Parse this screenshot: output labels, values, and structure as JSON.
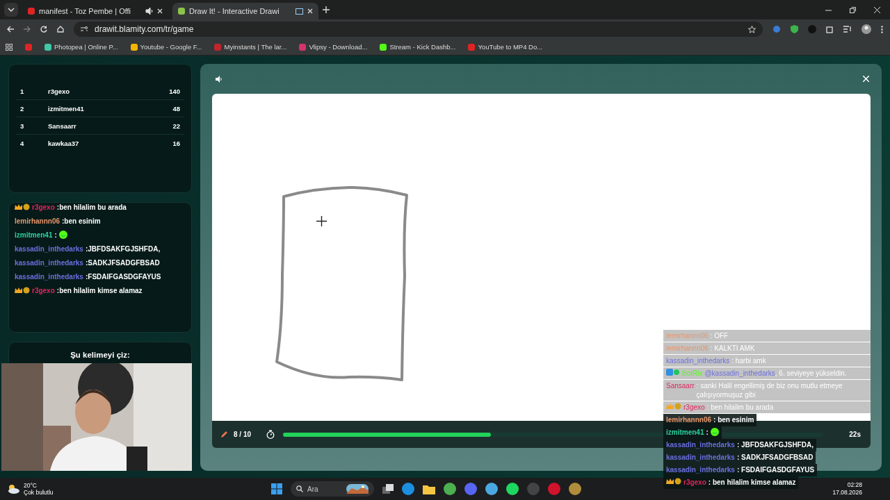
{
  "browser": {
    "tabs": [
      {
        "title": "manifest - Toz Pembe | Offi",
        "selected": false,
        "kind": "audio"
      },
      {
        "title": "Draw It! - Interactive Drawi",
        "selected": true,
        "kind": "cast"
      }
    ],
    "url": "drawit.blamity.com/tr/game",
    "bookmarks": [
      {
        "label": "Photopea | Online P...",
        "color": "#3ec9a7"
      },
      {
        "label": "Youtube - Google F...",
        "color": "#f4b400"
      },
      {
        "label": "Myinstants | The lar...",
        "color": "#c0262c"
      },
      {
        "label": "Vlipsy - Download...",
        "color": "#d6336c"
      },
      {
        "label": "Stream - Kick Dashb...",
        "color": "#53fc18"
      },
      {
        "label": "YouTube to MP4 Do...",
        "color": "#e02424"
      }
    ]
  },
  "leaderboard": [
    {
      "rank": "1",
      "name": "r3gexo",
      "score": "140"
    },
    {
      "rank": "2",
      "name": "izmitmen41",
      "score": "48"
    },
    {
      "rank": "3",
      "name": "Sansaarr",
      "score": "22"
    },
    {
      "rank": "4",
      "name": "kawkaa37",
      "score": "16"
    }
  ],
  "chat": [
    {
      "kind": "text",
      "crown": true,
      "name": "r3gexo",
      "color": "#e0245e",
      "text": ":ben hilalim bu arada"
    },
    {
      "kind": "text",
      "crown": false,
      "name": "lemirhannn06",
      "color": "#e8956a",
      "text": ":ben esinim"
    },
    {
      "kind": "emote",
      "crown": false,
      "name": "izmitmen41",
      "color": "#2ed3a0",
      "text": ":"
    },
    {
      "kind": "text",
      "crown": false,
      "name": "kassadin_inthedarks",
      "color": "#6b6fe0",
      "text": ":JBFDSAKFGJSHFDA,"
    },
    {
      "kind": "text",
      "crown": false,
      "name": "kassadin_inthedarks",
      "color": "#6b6fe0",
      "text": ":SADKJFSADGFBSAD"
    },
    {
      "kind": "text",
      "crown": false,
      "name": "kassadin_inthedarks",
      "color": "#6b6fe0",
      "text": ":FSDAIFGASDGFAYUS"
    },
    {
      "kind": "text",
      "crown": true,
      "name": "r3gexo",
      "color": "#e0245e",
      "text": ":ben hilalim kimse alamaz"
    }
  ],
  "word_prompt": "Şu kelimeyi çiz:",
  "game": {
    "round": "8 / 10",
    "time": "22s",
    "level": 0.385
  },
  "stream_chat": [
    {
      "faded": true,
      "kind": "plain",
      "name": "lemirhannn06",
      "color": "#e8956a",
      "text": ": OFF"
    },
    {
      "faded": true,
      "kind": "plain",
      "name": "lemirhannn06",
      "color": "#e8956a",
      "text": ": KALKTI AMK"
    },
    {
      "faded": true,
      "kind": "plain",
      "name": "kassadin_inthedarks",
      "color": "#6b6fe0",
      "text": ": harbi amk"
    },
    {
      "faded": true,
      "kind": "bot",
      "name": "BotRix",
      "color": "#53fc18",
      "mention": "@kassadin_inthedarks",
      "text": ", 6. seviyeye yükseldin."
    },
    {
      "faded": true,
      "kind": "plain",
      "name": "Sansaarr",
      "color": "#e0245e",
      "text": ": sanki Halil engellimiş de biz onu mutlu etmeye çalışıyormuşuz gibi"
    },
    {
      "faded": true,
      "kind": "crown",
      "name": "r3gexo",
      "color": "#e0245e",
      "text": ": ben hilalim bu arada"
    },
    {
      "faded": false,
      "kind": "plain",
      "name": "lemirhannn06",
      "color": "#e8956a",
      "text": ": ben esinim"
    },
    {
      "faded": false,
      "kind": "emote",
      "name": "izmitmen41",
      "color": "#2ed3a0",
      "text": ":"
    },
    {
      "faded": false,
      "kind": "plain",
      "name": "kassadin_inthedarks",
      "color": "#6b6fe0",
      "text": ": JBFDSAKFGJSHFDA,"
    },
    {
      "faded": false,
      "kind": "plain",
      "name": "kassadin_inthedarks",
      "color": "#6b6fe0",
      "text": ": SADKJFSADGFBSAD"
    },
    {
      "faded": false,
      "kind": "plain",
      "name": "kassadin_inthedarks",
      "color": "#6b6fe0",
      "text": ": FSDAIFGASDGFAYUS"
    },
    {
      "faded": false,
      "kind": "crown",
      "name": "r3gexo",
      "color": "#e0245e",
      "text": ": ben hilalim kimse alamaz"
    }
  ],
  "taskbar": {
    "temperature": "20°C",
    "weather": "Çok bulutlu",
    "search_placeholder": "Ara",
    "time": "02:28",
    "date": "17.08.2026"
  }
}
